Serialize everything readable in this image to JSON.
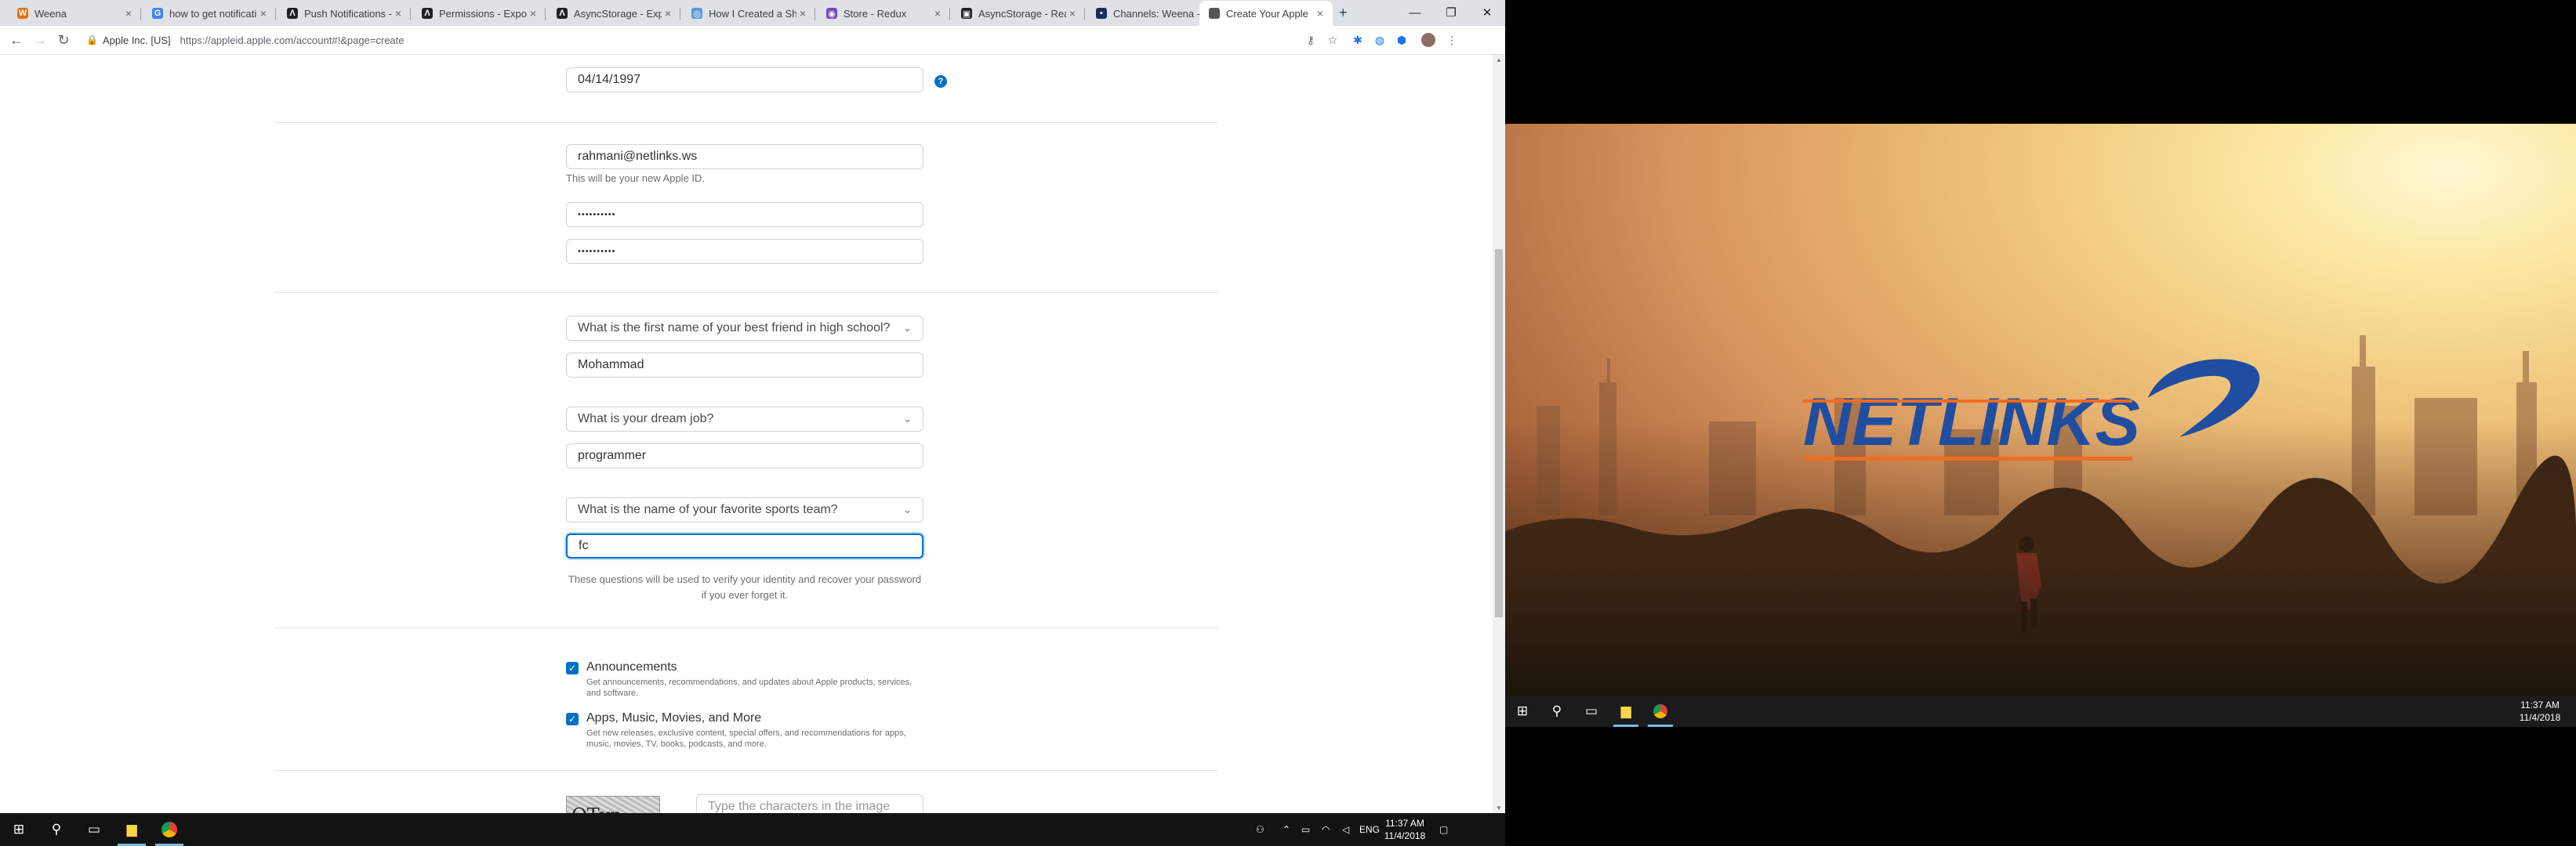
{
  "browser": {
    "tabs": [
      {
        "title": "Weena",
        "favicon_color": "#e8710a",
        "favicon_glyph": "W"
      },
      {
        "title": "how to get notificati",
        "favicon_color": "#4285f4",
        "favicon_glyph": "G"
      },
      {
        "title": "Push Notifications -",
        "favicon_color": "#202124",
        "favicon_glyph": "Λ"
      },
      {
        "title": "Permissions - Expo",
        "favicon_color": "#202124",
        "favicon_glyph": "Λ"
      },
      {
        "title": "AsyncStorage - Exp",
        "favicon_color": "#202124",
        "favicon_glyph": "Λ"
      },
      {
        "title": "How I Created a Sh",
        "favicon_color": "#5b9bd5",
        "favicon_glyph": "◎"
      },
      {
        "title": "Store - Redux",
        "favicon_color": "#764abc",
        "favicon_glyph": "◉"
      },
      {
        "title": "AsyncStorage - Rea",
        "favicon_color": "#202124",
        "favicon_glyph": "▣"
      },
      {
        "title": "Channels: Weena -",
        "favicon_color": "#1a2b5c",
        "favicon_glyph": "▪"
      },
      {
        "title": "Create Your Apple",
        "favicon_color": "#555555",
        "favicon_glyph": ""
      }
    ],
    "tab_close_glyph": "×",
    "new_tab_glyph": "+",
    "address": {
      "org": "Apple Inc. [US]",
      "url": "https://appleid.apple.com/account#!&page=create"
    }
  },
  "form": {
    "birthday": "04/14/1997",
    "help_glyph": "?",
    "email": "rahmani@netlinks.ws",
    "email_hint": "This will be your new Apple ID.",
    "password_mask": "••••••••••",
    "confirm_password_mask": "••••••••••",
    "security_questions": [
      {
        "question": "What is the first name of your best friend in high school?",
        "answer": "Mohammad"
      },
      {
        "question": "What is your dream job?",
        "answer": "programmer"
      },
      {
        "question": "What is the name of your favorite sports team?",
        "answer": "fc"
      }
    ],
    "security_hint": "These questions will be used to verify your identity and recover your password if you ever forget it.",
    "checkboxes": [
      {
        "title": "Announcements",
        "desc": "Get announcements, recommendations, and updates about Apple products, services, and software.",
        "checked": true
      },
      {
        "title": "Apps, Music, Movies, and More",
        "desc": "Get new releases, exclusive content, special offers, and recommendations for apps, music, movies, TV, books, podcasts, and more.",
        "checked": true
      }
    ],
    "captcha_text": "QTvn",
    "captcha_placeholder": "Type the characters in the image"
  },
  "taskbar_left": {
    "clock_time": "11:37 AM",
    "clock_date": "11/4/2018",
    "language": "ENG"
  },
  "desktop_right": {
    "logo_text": "NETLINKS",
    "clock_time": "11:37 AM",
    "clock_date": "11/4/2018"
  },
  "colors": {
    "accent": "#0070c9",
    "logo_blue": "#1f4ea1",
    "logo_orange": "#f36b21"
  }
}
